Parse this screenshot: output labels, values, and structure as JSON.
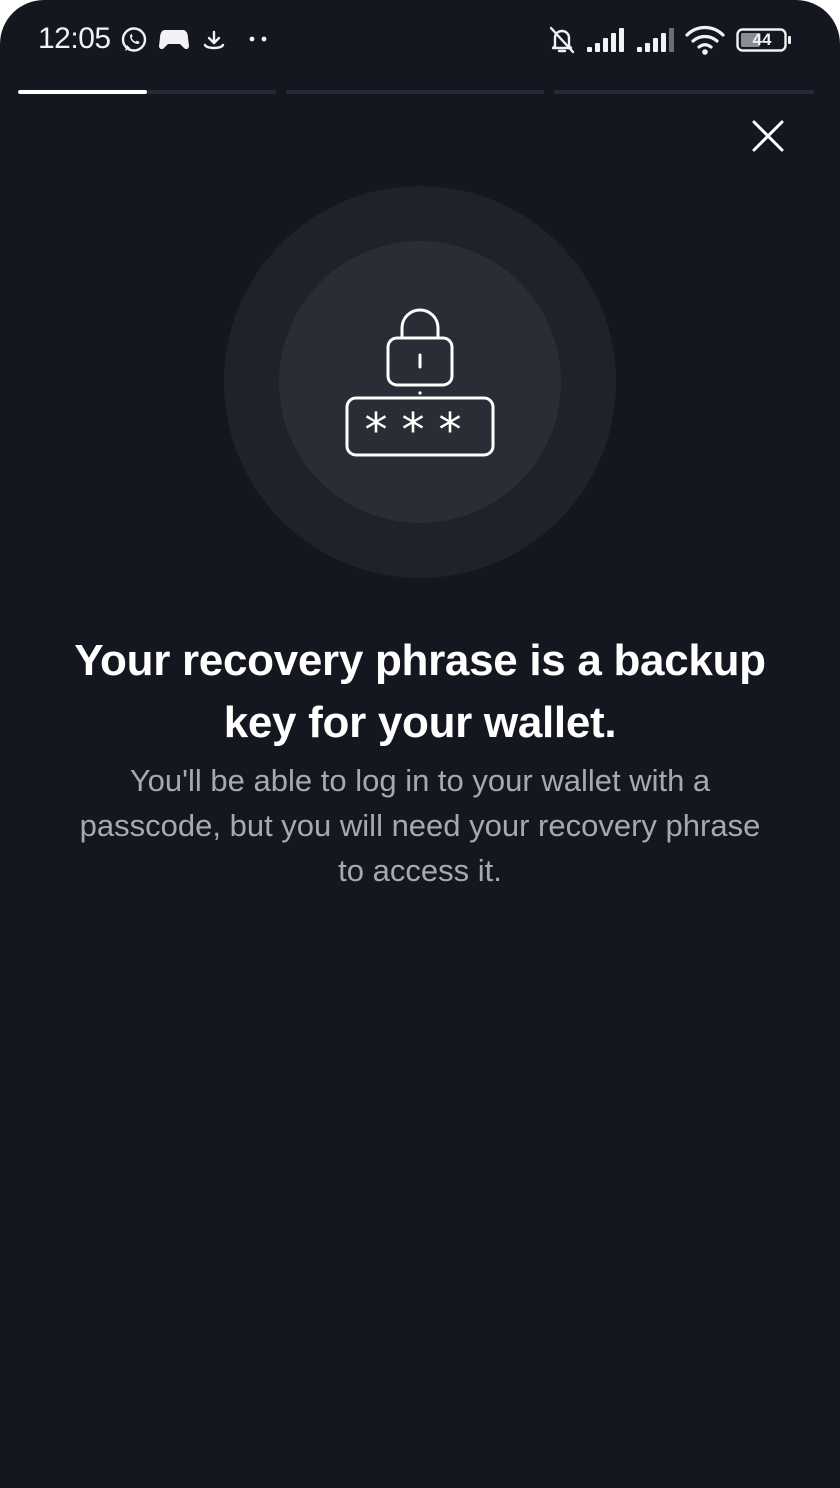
{
  "status_bar": {
    "time": "12:05",
    "battery": "44",
    "icons": [
      "whatsapp-icon",
      "game-controller-icon",
      "download-icon",
      "more-dots-icon",
      "bell-muted-icon",
      "signal-icon",
      "signal-icon",
      "wifi-icon",
      "battery-icon"
    ]
  },
  "progress": {
    "segments": 3,
    "current_segment_fill": 0.5
  },
  "close_button": {
    "icon": "close-icon"
  },
  "illustration": {
    "icon": "lock-passcode-icon",
    "masked_text": "***"
  },
  "content": {
    "headline": "Your recovery phrase is a backup key for your wallet.",
    "body": "You'll be able to log in to your wallet with a passcode, but you will need your recovery phrase to access it."
  },
  "colors": {
    "background": "#151720",
    "halo_outer": "#1f222b",
    "halo_inner": "#2a2d36",
    "headline": "#ffffff",
    "body": "#a7a9b1",
    "progress_track": "#262a36",
    "progress_fill": "#ffffff"
  }
}
